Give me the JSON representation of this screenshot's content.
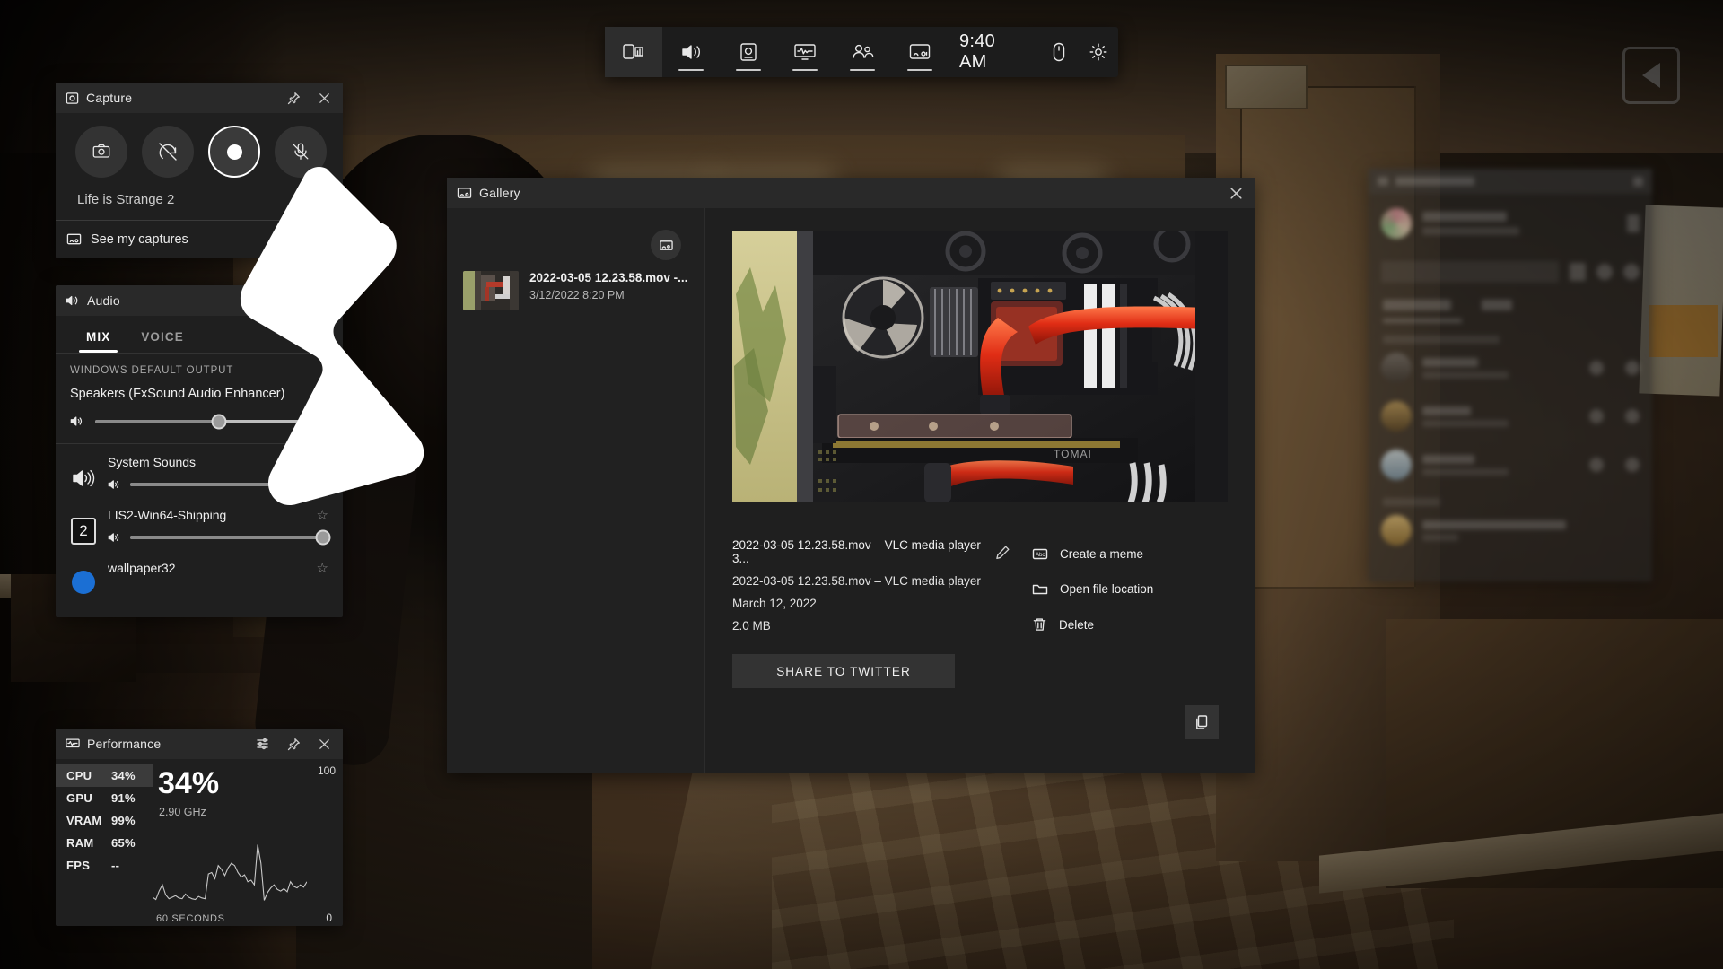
{
  "toolbar": {
    "items": [
      {
        "name": "widget-menu",
        "icon": "widgets-icon",
        "active": true,
        "underline": false
      },
      {
        "name": "audio",
        "icon": "volume-icon",
        "active": false,
        "underline": true
      },
      {
        "name": "capture",
        "icon": "capture-icon",
        "active": false,
        "underline": true
      },
      {
        "name": "performance",
        "icon": "performance-icon",
        "active": false,
        "underline": true
      },
      {
        "name": "xbox-social",
        "icon": "people-icon",
        "active": false,
        "underline": true
      },
      {
        "name": "gallery",
        "icon": "gallery-icon",
        "active": false,
        "underline": true
      }
    ],
    "clock": "9:40 AM",
    "right_icons": [
      {
        "name": "controller-icon",
        "label": "Controller"
      },
      {
        "name": "gear-icon",
        "label": "Settings"
      }
    ]
  },
  "capture": {
    "title": "Capture",
    "icon": "capture-icon",
    "buttons": [
      {
        "name": "screenshot-button",
        "icon": "camera-icon",
        "active": false
      },
      {
        "name": "record-last-30s-button",
        "icon": "record-last-disabled-icon",
        "active": false
      },
      {
        "name": "start-recording-button",
        "icon": "record-dot-icon",
        "active": true
      },
      {
        "name": "mic-toggle-button",
        "icon": "mic-muted-icon",
        "active": false
      }
    ],
    "game_name": "Life is Strange 2",
    "see_captures_label": "See my captures",
    "see_captures_icon": "gallery-icon",
    "pin_label": "Pin",
    "close_label": "Close"
  },
  "audio": {
    "title": "Audio",
    "icon": "volume-icon",
    "tabs": [
      {
        "label": "MIX",
        "active": true
      },
      {
        "label": "VOICE",
        "active": false
      }
    ],
    "section_caption": "WINDOWS DEFAULT OUTPUT",
    "device": "Speakers (FxSound Audio Enhancer)",
    "device_chevron": "chevron-down-icon",
    "master_volume_percent": 53,
    "apps": [
      {
        "name": "System Sounds",
        "icon": "volume-icon",
        "volume_percent": 100,
        "favorite": false
      },
      {
        "name": "LIS2-Win64-Shipping",
        "icon": "app-badge-2",
        "volume_percent": 100,
        "favorite": false
      },
      {
        "name": "wallpaper32",
        "icon": "app-blue-circle",
        "volume_percent": 100,
        "favorite": false
      }
    ]
  },
  "performance": {
    "title": "Performance",
    "icon": "performance-icon",
    "header_buttons": [
      {
        "name": "performance-options-button",
        "icon": "sliders-icon"
      },
      {
        "name": "pin-button",
        "icon": "pin-icon"
      },
      {
        "name": "close-button",
        "icon": "close-icon"
      }
    ],
    "metrics": [
      {
        "label": "CPU",
        "value": "34%",
        "selected": true
      },
      {
        "label": "GPU",
        "value": "91%",
        "selected": false
      },
      {
        "label": "VRAM",
        "value": "99%",
        "selected": false
      },
      {
        "label": "RAM",
        "value": "65%",
        "selected": false
      },
      {
        "label": "FPS",
        "value": "--",
        "selected": false
      }
    ],
    "big_value": "34%",
    "sub_value": "2.90 GHz",
    "axis_max": "100",
    "axis_min": "0",
    "time_range": "60 SECONDS"
  },
  "chart_data": {
    "type": "line",
    "title": "CPU utilization",
    "xlabel": "60 SECONDS",
    "ylabel": "%",
    "ylim": [
      0,
      100
    ],
    "xlim": [
      0,
      60
    ],
    "grid": false,
    "legend": "none",
    "series": [
      {
        "name": "CPU %",
        "values": [
          14,
          11,
          22,
          30,
          17,
          12,
          14,
          16,
          13,
          12,
          18,
          14,
          12,
          11,
          15,
          13,
          12,
          44,
          46,
          38,
          55,
          50,
          42,
          52,
          58,
          55,
          46,
          40,
          43,
          34,
          36,
          30,
          82,
          58,
          10,
          20,
          26,
          30,
          24,
          22,
          25,
          21,
          34,
          28,
          26,
          30,
          27,
          34
        ]
      }
    ]
  },
  "gallery": {
    "title": "Gallery",
    "icon": "gallery-icon",
    "close_label": "Close",
    "folder_button": {
      "name": "open-folder-button",
      "icon": "folder-open-icon"
    },
    "items": [
      {
        "name": "2022-03-05 12.23.58.mov -...",
        "date": "3/12/2022 8:20 PM",
        "thumbnail": "pc-watercooling-thumb"
      }
    ],
    "detail": {
      "preview_alt": "PC interior with red liquid cooling loop",
      "title": "2022-03-05 12.23.58.mov – VLC media player 3...",
      "edit_icon": "pencil-icon",
      "subtitle": "2022-03-05 12.23.58.mov – VLC media player",
      "date": "March 12, 2022",
      "size": "2.0 MB",
      "share_button": "SHARE TO TWITTER",
      "actions": [
        {
          "label": "Create a meme",
          "icon": "meme-abc-icon"
        },
        {
          "label": "Open file location",
          "icon": "folder-icon"
        },
        {
          "label": "Delete",
          "icon": "trash-icon"
        }
      ],
      "copy_button": {
        "name": "copy-button",
        "icon": "copy-icon"
      }
    }
  },
  "social": {
    "title": "Xbox Social",
    "blurred": true
  },
  "colors": {
    "widget_bg": "#1f1f1f",
    "widget_header_bg": "#292929",
    "accent_white": "#ffffff",
    "text_primary": "#efefef",
    "text_secondary": "#b4b4b4",
    "button_bg": "#333333",
    "selected_bg": "#3b3b3b"
  }
}
